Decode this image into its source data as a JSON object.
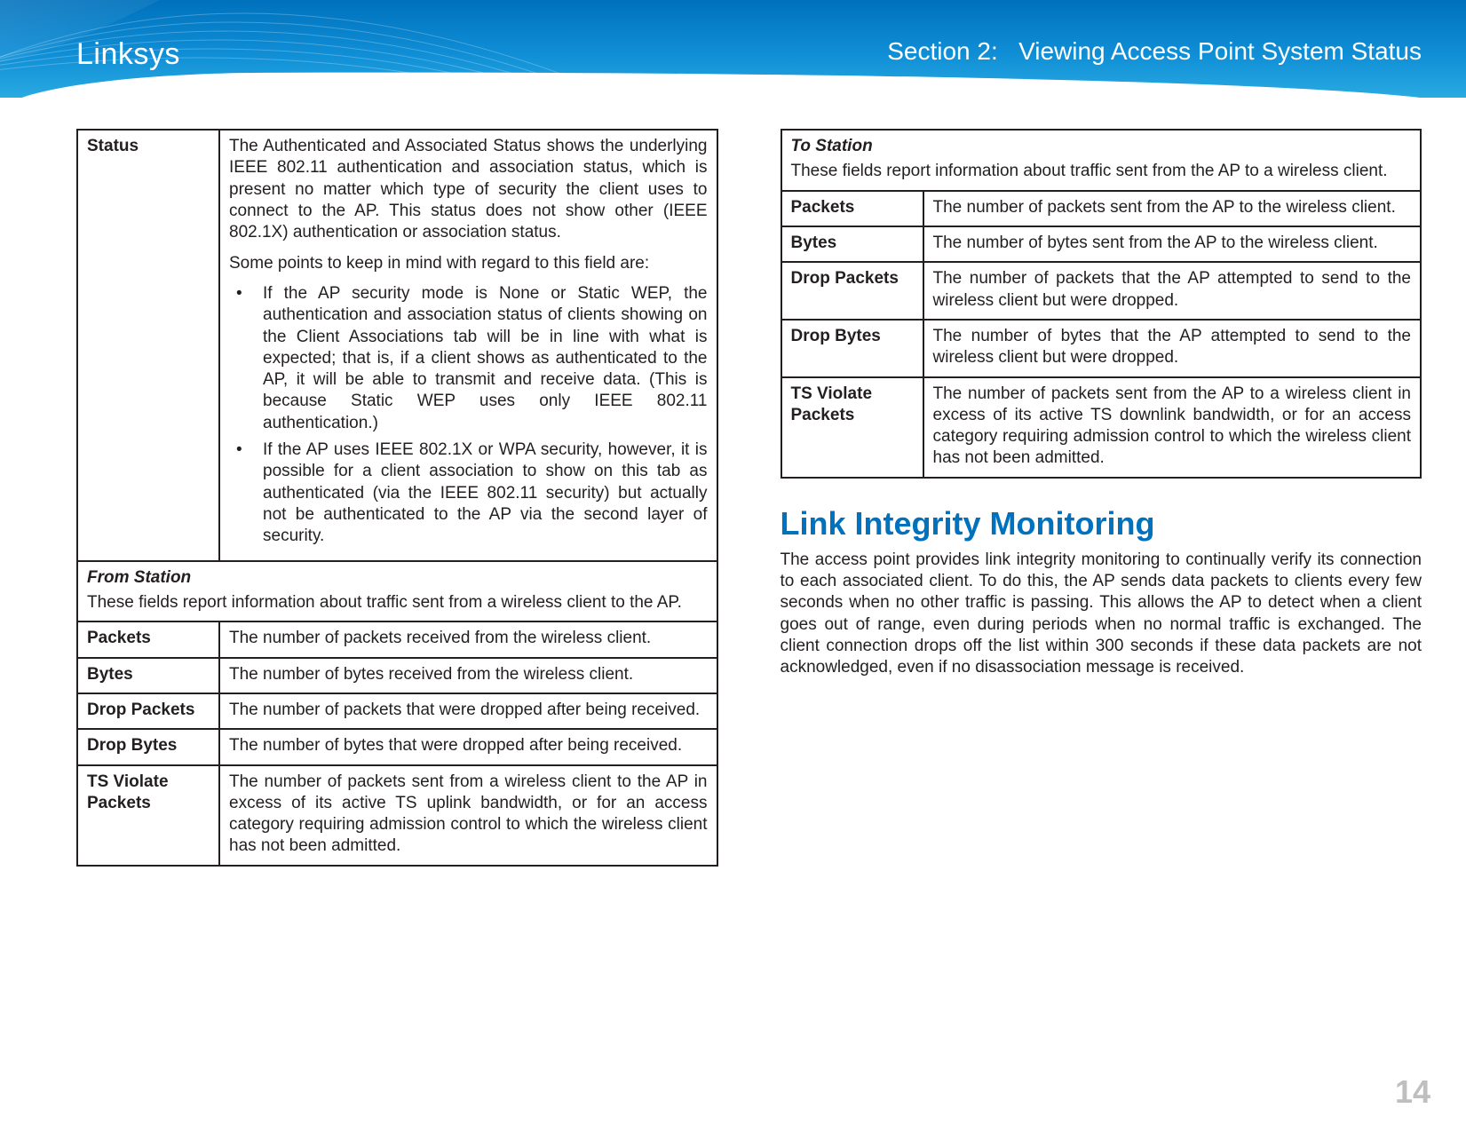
{
  "header": {
    "brand": "Linksys",
    "section_label": "Section 2:",
    "section_text": "Viewing Access Point System Status"
  },
  "left": {
    "status_label": "Status",
    "status_p1": "The Authenticated and Associated Status shows the underlying IEEE 802.11 authentication and association status, which is present no matter which type of security the client uses to connect to the AP. This status does not show other (IEEE 802.1X) authentication or association status.",
    "status_p2": "Some points to keep in mind with regard to this field are:",
    "status_b1": "If the AP security mode is None or Static WEP, the authentication and association status of clients showing on the Client Associations tab will be in line with what is expected; that is, if a client shows as authenticated to the AP, it will be able to transmit and receive data. (This is because Static WEP uses only IEEE 802.11 authentication.)",
    "status_b2": "If the AP uses IEEE 802.1X or WPA security, however, it is possible for a client association to show on this tab as authenticated (via the IEEE 802.11 security) but actually not be authenticated to the AP via the second layer of security.",
    "from_title": "From Station",
    "from_desc": "These fields report information about traffic sent from a wireless client to the AP.",
    "rows": [
      {
        "label": "Packets",
        "desc": "The number of packets received from the wireless client."
      },
      {
        "label": "Bytes",
        "desc": "The number of bytes received from the wireless client."
      },
      {
        "label": "Drop Packets",
        "desc": "The number of packets that were dropped after being received."
      },
      {
        "label": "Drop Bytes",
        "desc": "The number of bytes that were dropped after being received."
      },
      {
        "label": "TS Violate Packets",
        "desc": "The number of packets sent from a wireless client to the AP in excess of its active TS uplink bandwidth, or for an access category requiring admission control to which the wireless client has not been admitted."
      }
    ]
  },
  "right": {
    "to_title": "To Station",
    "to_desc": "These fields report information about traffic sent from the AP to a wireless client.",
    "rows": [
      {
        "label": "Packets",
        "desc": "The number of packets sent from the AP to the wireless client."
      },
      {
        "label": "Bytes",
        "desc": "The number of bytes sent from the AP to the wireless client."
      },
      {
        "label": "Drop Packets",
        "desc": "The number of packets that the AP attempted to send to the wireless client but were dropped."
      },
      {
        "label": "Drop Bytes",
        "desc": "The number of bytes that the AP attempted to send to the wireless client but were dropped."
      },
      {
        "label": "TS Violate  Packets",
        "desc": "The number of packets sent from the AP to a wireless client in excess of its active TS downlink bandwidth, or for an access category requiring admission control to which the wireless client has not been admitted."
      }
    ],
    "h2": "Link Integrity Monitoring",
    "body": "The access point provides link integrity monitoring to continually verify its connection to each associated client. To do this, the AP sends data packets to clients every few seconds when no other traffic is passing. This allows the AP to detect when a client goes out of range, even during periods when no normal traffic is exchanged. The client connection drops off the list within 300 seconds if these data packets are not acknowledged, even if no disassociation message is received."
  },
  "page_number": "14"
}
